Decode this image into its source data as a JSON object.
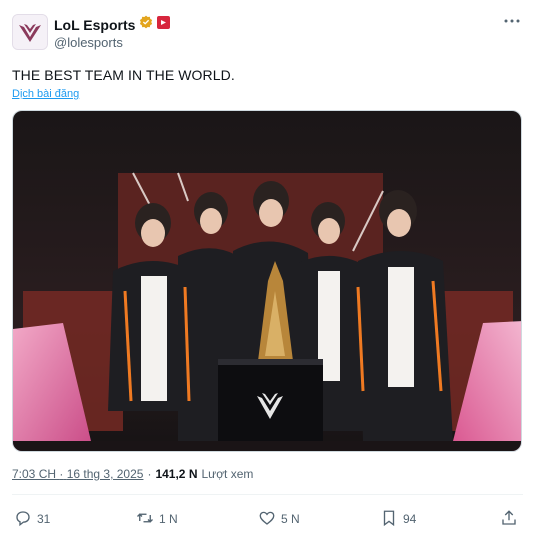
{
  "account": {
    "name": "LoL Esports",
    "handle": "@lolesports",
    "verified_badge_color": "#e3a51e",
    "affiliate_badge_color": "#d7263d"
  },
  "tweet": {
    "text": "THE BEST TEAM IN THE WORLD.",
    "translate_label": "Dịch bài đăng"
  },
  "meta": {
    "time": "7:03 CH",
    "separator": "·",
    "date": "16 thg 3, 2025",
    "views_count": "141,2 N",
    "views_label": "Lượt xem"
  },
  "actions": {
    "reply_count": "31",
    "retweet_count": "1 N",
    "like_count": "5 N",
    "bookmark_count": "94"
  },
  "icons": {
    "more": "more-dots-icon",
    "reply": "reply-icon",
    "retweet": "retweet-icon",
    "like": "heart-icon",
    "bookmark": "bookmark-icon",
    "share": "share-icon"
  },
  "colors": {
    "link": "#1d9bf0",
    "secondary_text": "#536471",
    "stage_pink": "#e0528a"
  }
}
